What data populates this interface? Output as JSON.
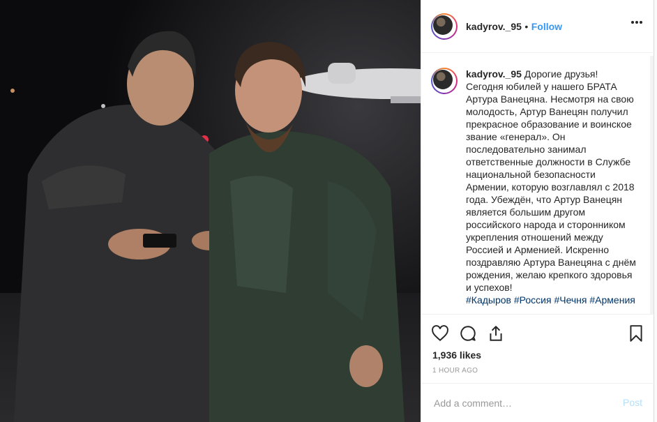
{
  "header": {
    "username": "kadyrov._95",
    "separator": "•",
    "follow_label": "Follow"
  },
  "caption": {
    "username": "kadyrov._95",
    "text": "Дорогие друзья! Сегодня юбилей у нашего БРАТА Артура Ванецяна. Несмотря на свою молодость, Артур Ванецян получил прекрасное образование и воинское звание «генерал». Он последовательно занимал ответственные должности в Службе национальной безопасности Армении, которую возглавлял с 2018 года. Убеждён, что Артур Ванецян является большим другом российского народа и сторонником укрепления отношений между Россией и Арменией. Искренно поздравляю Артура Ванецяна с днём рождения, желаю крепкого здоровья и успехов!",
    "hashtags": [
      "#Кадыров",
      "#Россия",
      "#Чечня",
      "#Армения"
    ]
  },
  "actions": {
    "like_icon": "heart-icon",
    "comment_icon": "comment-icon",
    "share_icon": "share-icon",
    "save_icon": "bookmark-icon"
  },
  "likes": "1,936 likes",
  "timestamp": "1 HOUR AGO",
  "add_comment": {
    "placeholder": "Add a comment…",
    "post_label": "Post"
  },
  "colors": {
    "link": "#3897f0",
    "hashtag": "#003569",
    "post_disabled": "#b2dffc"
  }
}
